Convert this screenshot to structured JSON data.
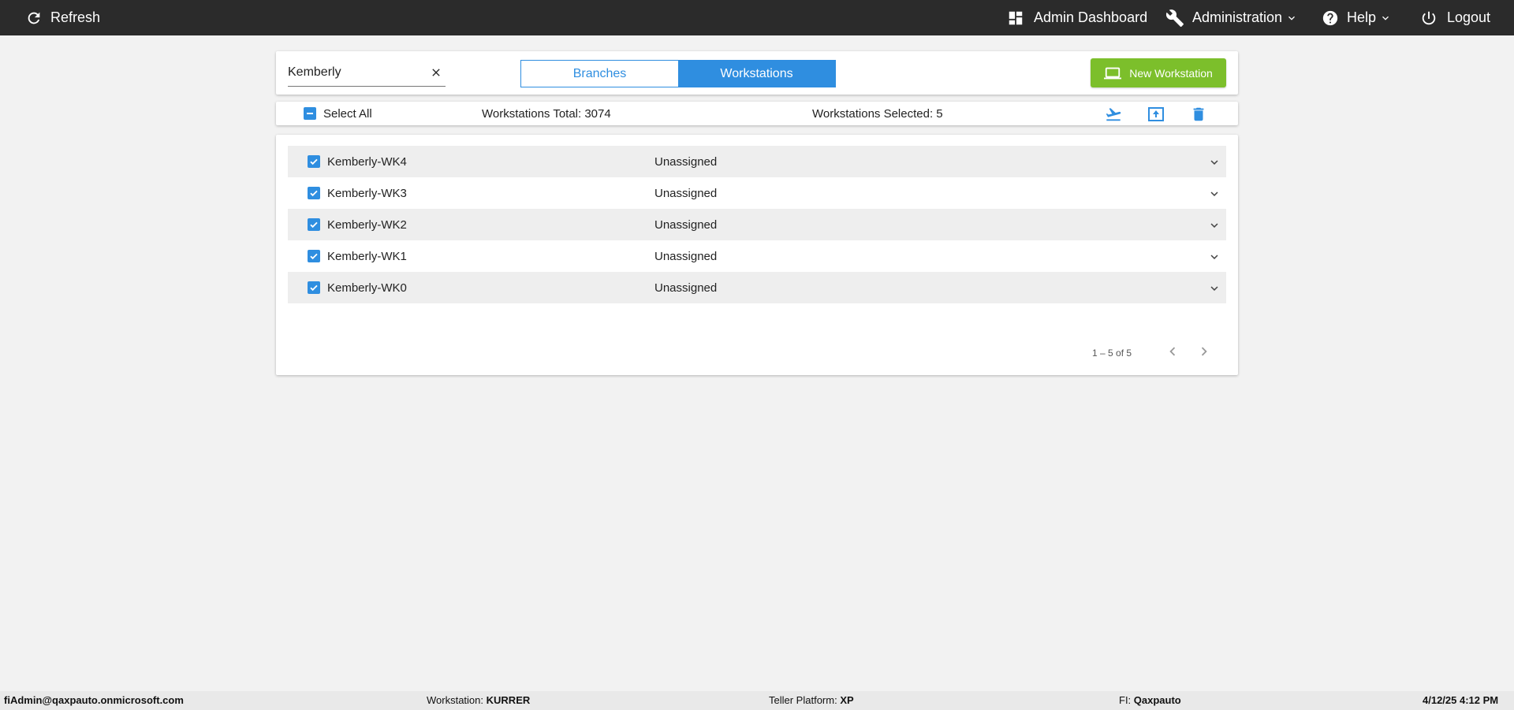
{
  "topbar": {
    "refresh_label": "Refresh",
    "admin_dashboard_label": "Admin Dashboard",
    "administration_label": "Administration",
    "help_label": "Help",
    "logout_label": "Logout",
    "background": "#2b2b2b"
  },
  "search": {
    "value": "Kemberly",
    "placeholder": ""
  },
  "tabs": [
    {
      "label": "Branches",
      "active": false
    },
    {
      "label": "Workstations",
      "active": true
    }
  ],
  "new_workstation_label": "New Workstation",
  "summary": {
    "select_all_label": "Select All",
    "total_text": "Workstations Total: 3074",
    "selected_text": "Workstations Selected: 5"
  },
  "rows": [
    {
      "name": "Kemberly-WK4",
      "status": "Unassigned",
      "checked": true
    },
    {
      "name": "Kemberly-WK3",
      "status": "Unassigned",
      "checked": true
    },
    {
      "name": "Kemberly-WK2",
      "status": "Unassigned",
      "checked": true
    },
    {
      "name": "Kemberly-WK1",
      "status": "Unassigned",
      "checked": true
    },
    {
      "name": "Kemberly-WK0",
      "status": "Unassigned",
      "checked": true
    }
  ],
  "pagination": {
    "range_text": "1 – 5 of 5"
  },
  "footer": {
    "user": "fiAdmin@qaxpauto.onmicrosoft.com",
    "workstation_label": "Workstation:",
    "workstation_value": "KURRER",
    "teller_platform_label": "Teller Platform:",
    "teller_platform_value": "XP",
    "fi_label": "FI:",
    "fi_value": "Qaxpauto",
    "datetime": "4/12/25 4:12 PM"
  },
  "colors": {
    "accent": "#2f8ee0",
    "success": "#7cbf2b",
    "row_shade": "#eeeeee"
  },
  "icons": [
    "refresh-icon",
    "dashboard-icon",
    "wrench-icon",
    "help-icon",
    "power-icon",
    "close-icon",
    "laptop-icon",
    "checkbox-indeterminate-icon",
    "transfer-icon",
    "upload-icon",
    "trash-icon",
    "checkbox-checked-icon",
    "chevron-down-icon",
    "chevron-left-icon",
    "chevron-right-icon"
  ]
}
